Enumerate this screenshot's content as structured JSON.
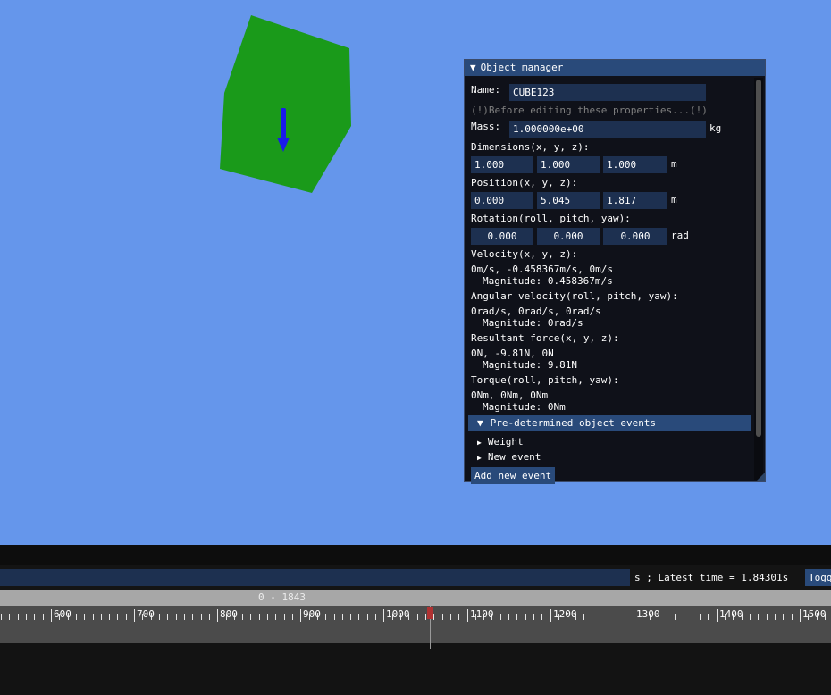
{
  "panel": {
    "title": "Object manager",
    "name_label": "Name:",
    "name_value": "CUBE123",
    "warning": "(!)Before editing these properties...(!)",
    "mass_label": "Mass:",
    "mass_value": "1.000000e+00",
    "mass_unit": "kg",
    "dimensions_label": "Dimensions(x, y, z):",
    "dimensions": [
      "1.000",
      "1.000",
      "1.000"
    ],
    "dimensions_unit": "m",
    "position_label": "Position(x, y, z):",
    "position": [
      "0.000",
      "5.045",
      "1.817"
    ],
    "position_unit": "m",
    "rotation_label": "Rotation(roll, pitch, yaw):",
    "rotation": [
      "0.000",
      "0.000",
      "0.000"
    ],
    "rotation_unit": "rad",
    "velocity_label": "Velocity(x, y, z):",
    "velocity_value": "0m/s, -0.458367m/s, 0m/s",
    "velocity_mag": "Magnitude: 0.458367m/s",
    "angvel_label": "Angular velocity(roll, pitch, yaw):",
    "angvel_value": "0rad/s, 0rad/s, 0rad/s",
    "angvel_mag": "Magnitude: 0rad/s",
    "force_label": "Resultant force(x, y, z):",
    "force_value": "0N, -9.81N, 0N",
    "force_mag": "Magnitude: 9.81N",
    "torque_label": "Torque(roll, pitch, yaw):",
    "torque_value": "0Nm, 0Nm, 0Nm",
    "torque_mag": "Magnitude: 0Nm",
    "events_header": "Pre-determined object events",
    "events": [
      "Weight",
      "New event"
    ],
    "add_event_button": "Add new event"
  },
  "timeline": {
    "latest_time": "s ; Latest time = 1.84301s",
    "toggle_button": "Togg",
    "range_label": "0 - 1843",
    "tick_labels": [
      "600",
      "700",
      "800",
      "900",
      "1000",
      "1100",
      "1200",
      "1300",
      "1400",
      "1500"
    ],
    "cursor_value": 1000
  },
  "colors": {
    "scene_background": "#6596eb",
    "cube": "#1a9a1a",
    "arrow": "#1a1aeb",
    "header": "#294a7a",
    "field": "#1d3050",
    "cursor": "#b03232"
  }
}
